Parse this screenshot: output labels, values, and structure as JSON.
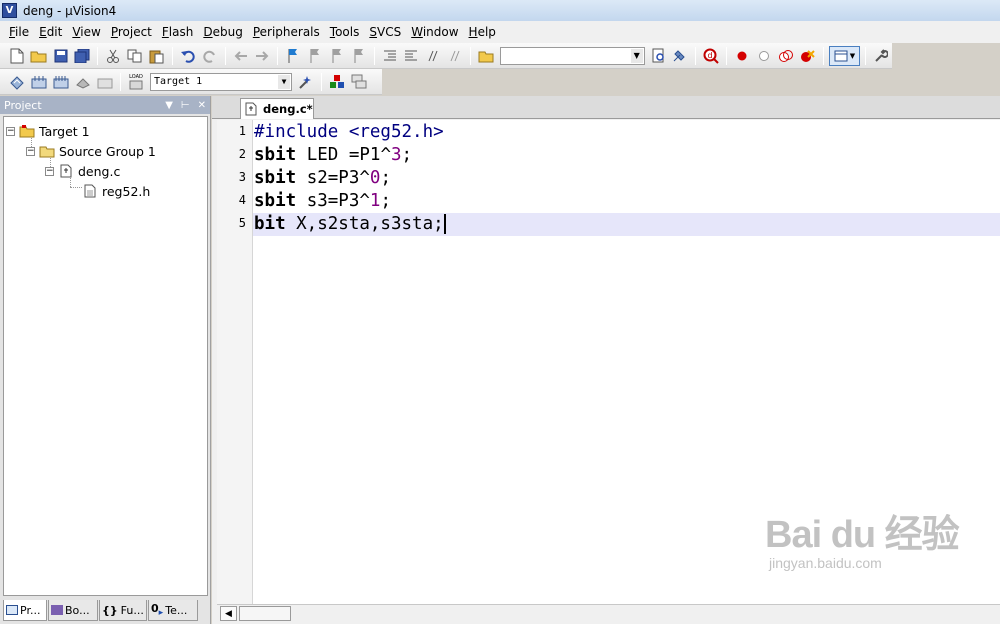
{
  "window": {
    "title": "deng - μVision4",
    "app_icon_glyph": "V"
  },
  "menu": [
    "File",
    "Edit",
    "View",
    "Project",
    "Flash",
    "Debug",
    "Peripherals",
    "Tools",
    "SVCS",
    "Window",
    "Help"
  ],
  "toolbar2": {
    "target_value": "Target 1",
    "load_label": "LOAD"
  },
  "project_panel": {
    "title": "Project",
    "tree": {
      "target": "Target 1",
      "group": "Source Group 1",
      "file": "deng.c",
      "header": "reg52.h"
    },
    "tabs": [
      "Pr...",
      "Bo...",
      "Fu...",
      "Te..."
    ]
  },
  "editor": {
    "tab_label": "deng.c*",
    "lines": [
      {
        "num": "1",
        "segments": [
          {
            "t": "#include <reg52.h>",
            "c": "pre"
          }
        ]
      },
      {
        "num": "2",
        "segments": [
          {
            "t": "sbit",
            "c": "kw"
          },
          {
            "t": " LED =P1^",
            "c": ""
          },
          {
            "t": "3",
            "c": "num"
          },
          {
            "t": ";",
            "c": ""
          }
        ]
      },
      {
        "num": "3",
        "segments": [
          {
            "t": "sbit",
            "c": "kw"
          },
          {
            "t": " s2=P3^",
            "c": ""
          },
          {
            "t": "0",
            "c": "num"
          },
          {
            "t": ";",
            "c": ""
          }
        ]
      },
      {
        "num": "4",
        "segments": [
          {
            "t": "sbit",
            "c": "kw"
          },
          {
            "t": " s3=P3^",
            "c": ""
          },
          {
            "t": "1",
            "c": "num"
          },
          {
            "t": ";",
            "c": ""
          }
        ]
      },
      {
        "num": "5",
        "segments": [
          {
            "t": "bit",
            "c": "kw"
          },
          {
            "t": " X,s2sta,s3sta;",
            "c": ""
          }
        ]
      }
    ],
    "current_line": "5"
  },
  "watermark": {
    "brand": "Bai du 经验",
    "url": "jingyan.baidu.com"
  },
  "colors": {
    "titlebar": "#c3d7ee",
    "current_line": "#e6e6fa",
    "number_literal": "#800080",
    "preprocessor": "#000080",
    "breakpoint": "#d40000"
  }
}
